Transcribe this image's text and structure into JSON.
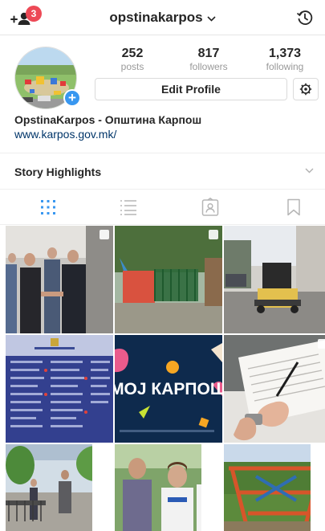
{
  "header": {
    "username": "opstinakarpos",
    "notification_count": "3",
    "icons": {
      "add_user": "add-user-icon",
      "dropdown": "chevron-down-icon",
      "history": "history-icon"
    }
  },
  "profile": {
    "stats": [
      {
        "value": "252",
        "label": "posts"
      },
      {
        "value": "817",
        "label": "followers"
      },
      {
        "value": "1,373",
        "label": "following"
      }
    ],
    "edit_button_label": "Edit Profile",
    "full_name": "OpstinaKarpos - Општина Карпош",
    "website": "www.karpos.gov.mk/"
  },
  "highlights": {
    "title": "Story Highlights"
  },
  "tabs": [
    "grid-icon",
    "list-icon",
    "tagged-icon",
    "saved-icon"
  ],
  "colors": {
    "accent": "#3897f0",
    "badge": "#ed4956",
    "link": "#003569"
  },
  "grid": {
    "post_text": "МОЈ КАРПОШ"
  }
}
